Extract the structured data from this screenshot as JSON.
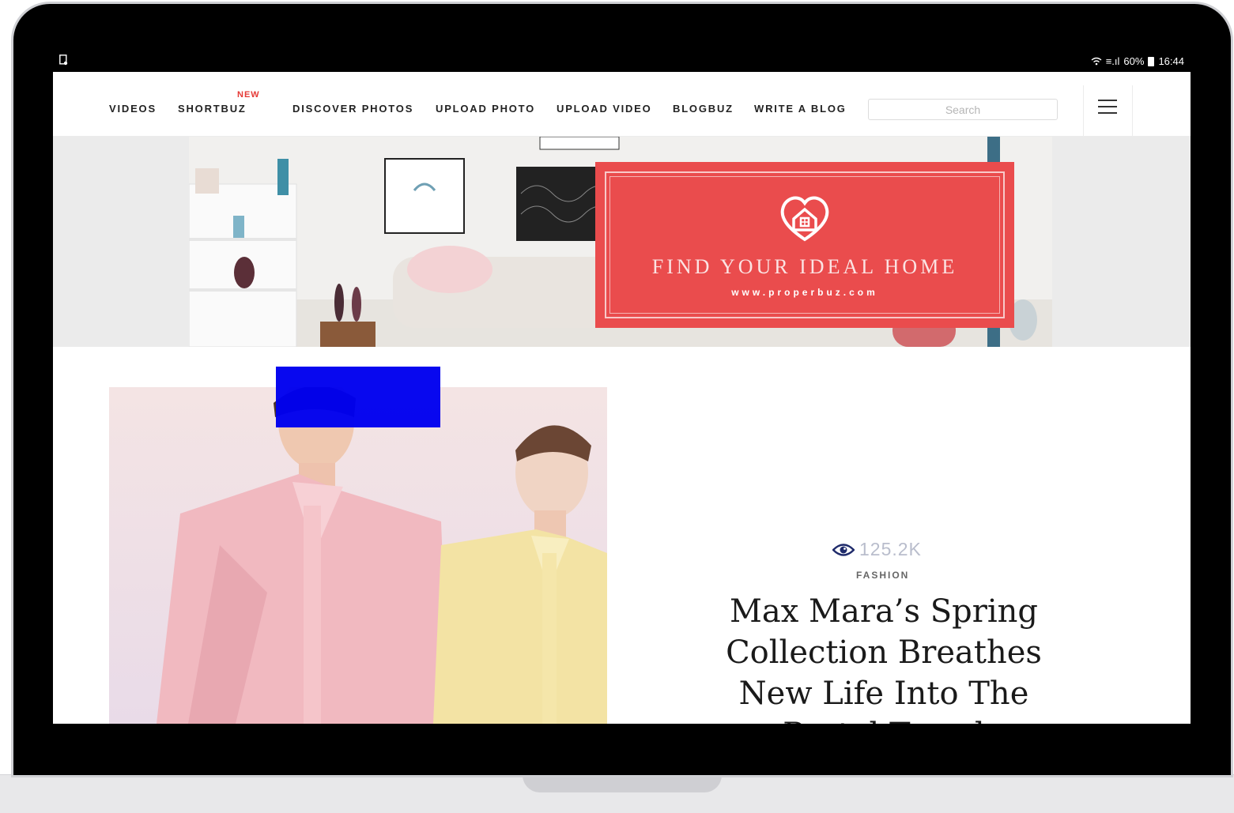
{
  "status_bar": {
    "signal": "≡.ıl",
    "battery": "60%",
    "time": "16:44"
  },
  "nav": {
    "items": [
      {
        "label": "VIDEOS"
      },
      {
        "label": "SHORTBUZ",
        "badge": "NEW"
      },
      {
        "label": "DISCOVER PHOTOS"
      },
      {
        "label": "UPLOAD PHOTO"
      },
      {
        "label": "UPLOAD VIDEO"
      },
      {
        "label": "BLOGBUZ"
      },
      {
        "label": "WRITE A BLOG"
      }
    ],
    "search_placeholder": "Search",
    "menu_icon": "hamburger-menu-icon"
  },
  "banner": {
    "title": "FIND YOUR IDEAL HOME",
    "url": "www.properbuz.com",
    "icon": "heart-home-icon",
    "accent_color": "#ea4c4d"
  },
  "article": {
    "views": "125.2K",
    "views_icon": "eye-icon",
    "category": "FASHION",
    "headline": "Max Mara’s Spring Collection Breathes New Life Into The Pastel Trend"
  }
}
